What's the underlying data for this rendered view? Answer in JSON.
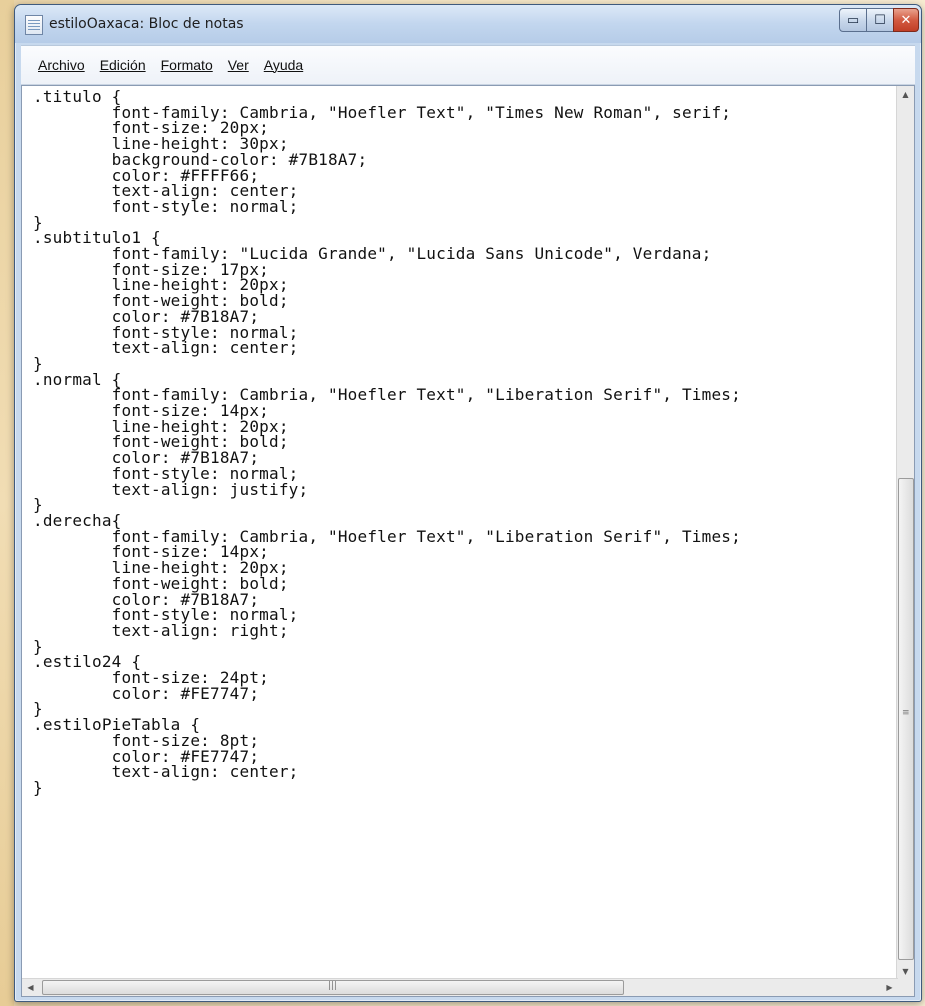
{
  "window": {
    "title": "estiloOaxaca: Bloc de notas",
    "minimize_glyph": "▭",
    "maximize_glyph": "☐",
    "close_glyph": "✕"
  },
  "menu": {
    "items": [
      {
        "label": "Archivo"
      },
      {
        "label": "Edición"
      },
      {
        "label": "Formato"
      },
      {
        "label": "Ver"
      },
      {
        "label": "Ayuda"
      }
    ]
  },
  "editor": {
    "lines": [
      ".titulo {",
      "        font-family: Cambria, \"Hoefler Text\", \"Times New Roman\", serif;",
      "        font-size: 20px;",
      "        line-height: 30px;",
      "        background-color: #7B18A7;",
      "        color: #FFFF66;",
      "        text-align: center;",
      "        font-style: normal;",
      "}",
      ".subtitulo1 {",
      "        font-family: \"Lucida Grande\", \"Lucida Sans Unicode\", Verdana;",
      "        font-size: 17px;",
      "        line-height: 20px;",
      "        font-weight: bold;",
      "        color: #7B18A7;",
      "        font-style: normal;",
      "        text-align: center;",
      "}",
      ".normal {",
      "        font-family: Cambria, \"Hoefler Text\", \"Liberation Serif\", Times;",
      "        font-size: 14px;",
      "        line-height: 20px;",
      "        font-weight: bold;",
      "        color: #7B18A7;",
      "        font-style: normal;",
      "        text-align: justify;",
      "}",
      ".derecha{",
      "        font-family: Cambria, \"Hoefler Text\", \"Liberation Serif\", Times;",
      "        font-size: 14px;",
      "        line-height: 20px;",
      "        font-weight: bold;",
      "        color: #7B18A7;",
      "        font-style: normal;",
      "        text-align: right;",
      "}",
      ".estilo24 {",
      "        font-size: 24pt;",
      "        color: #FE7747;",
      "}",
      ".estiloPieTabla {",
      "        font-size: 8pt;",
      "        color: #FE7747;",
      "        text-align: center;",
      "}"
    ]
  },
  "scrollbars": {
    "up_arrow": "▲",
    "down_arrow": "▼",
    "left_arrow": "◀",
    "right_arrow": "▶",
    "v_grip": "≡",
    "h_grip": "|||"
  }
}
